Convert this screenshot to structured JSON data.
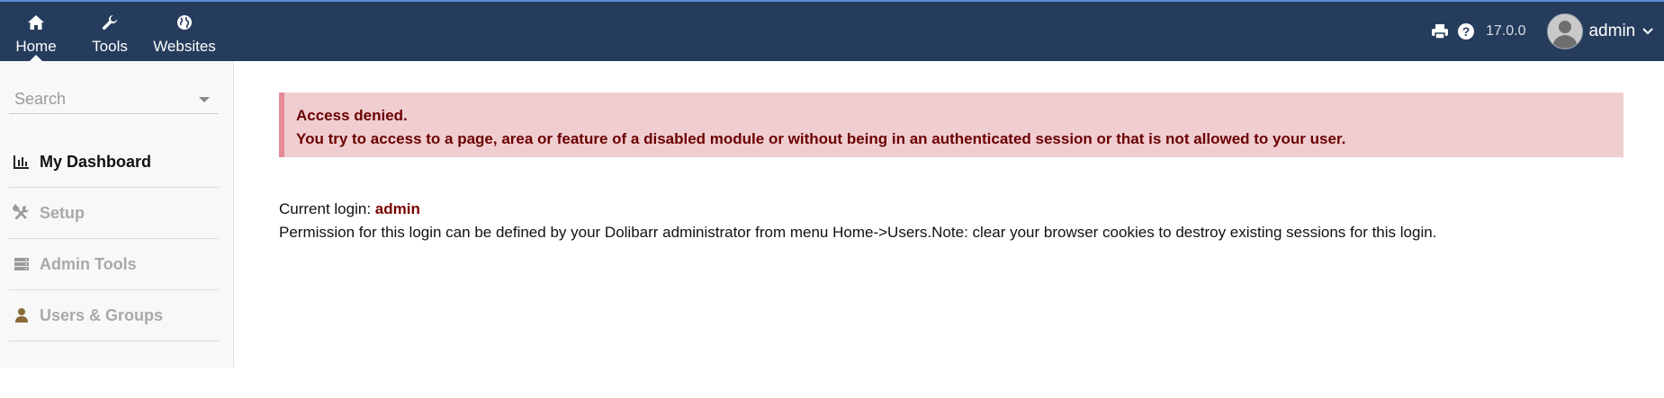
{
  "topnav": {
    "items": [
      {
        "label": "Home",
        "icon": "home-icon"
      },
      {
        "label": "Tools",
        "icon": "wrench-icon"
      },
      {
        "label": "Websites",
        "icon": "globe-icon"
      }
    ]
  },
  "header": {
    "version": "17.0.0",
    "user": "admin",
    "icons": [
      "print-icon",
      "help-icon",
      "avatar",
      "chevron-down-icon"
    ]
  },
  "sidebar": {
    "search_placeholder": "Search",
    "items": [
      {
        "label": "My Dashboard",
        "icon": "chart-icon",
        "active": true
      },
      {
        "label": "Setup",
        "icon": "tools-icon",
        "active": false
      },
      {
        "label": "Admin Tools",
        "icon": "server-icon",
        "active": false
      },
      {
        "label": "Users & Groups",
        "icon": "user-icon",
        "active": false
      }
    ]
  },
  "alert": {
    "title": "Access denied.",
    "message": "You try to access to a page, area or feature of a disabled module or without being in an authenticated session or that is not allowed to your user."
  },
  "main": {
    "current_login_label": "Current login: ",
    "current_login_value": "admin",
    "permission_note": "Permission for this login can be defined by your Dolibarr administrator from menu Home->Users.Note: clear your browser cookies to destroy existing sessions for this login."
  },
  "colors": {
    "topbar": "#263c5c",
    "alert_bg": "#f0cdd0",
    "alert_text": "#6b0000",
    "alert_border": "#e58a97"
  }
}
